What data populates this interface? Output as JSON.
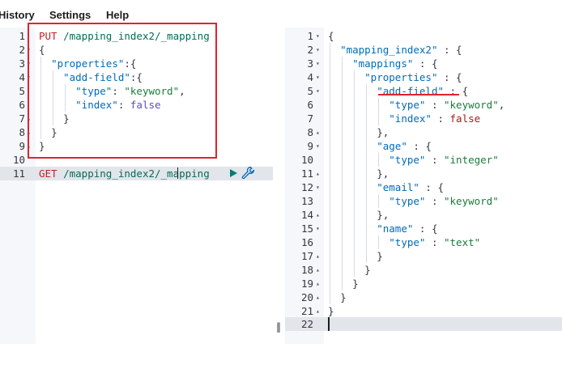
{
  "menu": {
    "history": "History",
    "settings": "Settings",
    "help": "Help"
  },
  "request_editor": {
    "line_numbers": [
      "1",
      "2",
      "3",
      "4",
      "5",
      "6",
      "7",
      "8",
      "9",
      "10",
      "11"
    ],
    "method_put": "PUT",
    "url_put": "/mapping_index2/_mapping",
    "open_brace": "{",
    "properties_key": "\"properties\"",
    "colon_brace": ":{",
    "add_field_key": "\"add-field\"",
    "type_key": "\"type\"",
    "type_value": "\"keyword\"",
    "index_key": "\"index\"",
    "index_value": "false",
    "close_brace": "}",
    "method_get": "GET",
    "url_get": "/mapping_index2/_mapping"
  },
  "response_viewer": {
    "line_numbers": [
      "1",
      "2",
      "3",
      "4",
      "5",
      "6",
      "7",
      "8",
      "9",
      "10",
      "11",
      "12",
      "13",
      "14",
      "15",
      "16",
      "17",
      "18",
      "19",
      "20",
      "21",
      "22"
    ],
    "index_key": "\"mapping_index2\"",
    "mappings_key": "\"mappings\"",
    "properties_key": "\"properties\"",
    "add_field_key": "\"add-field\"",
    "type_key": "\"type\"",
    "keyword_value": "\"keyword\"",
    "index_prop_key": "\"index\"",
    "false_value": "false",
    "age_key": "\"age\"",
    "integer_value": "\"integer\"",
    "email_key": "\"email\"",
    "name_key": "\"name\"",
    "text_value": "\"text\"",
    "colon_open": " : {",
    "colon": " : ",
    "comma": ",",
    "open_brace": "{",
    "close_brace": "}",
    "close_brace_comma": "},"
  },
  "icons": {
    "run": "play-icon",
    "settings": "wrench-icon",
    "fold": "triangle-icon"
  },
  "colors": {
    "annotation": "#e0232f",
    "method": "#c61e25",
    "url": "#056b56",
    "key": "#006bb8",
    "string": "#1c7b3d",
    "run": "#017d73"
  }
}
